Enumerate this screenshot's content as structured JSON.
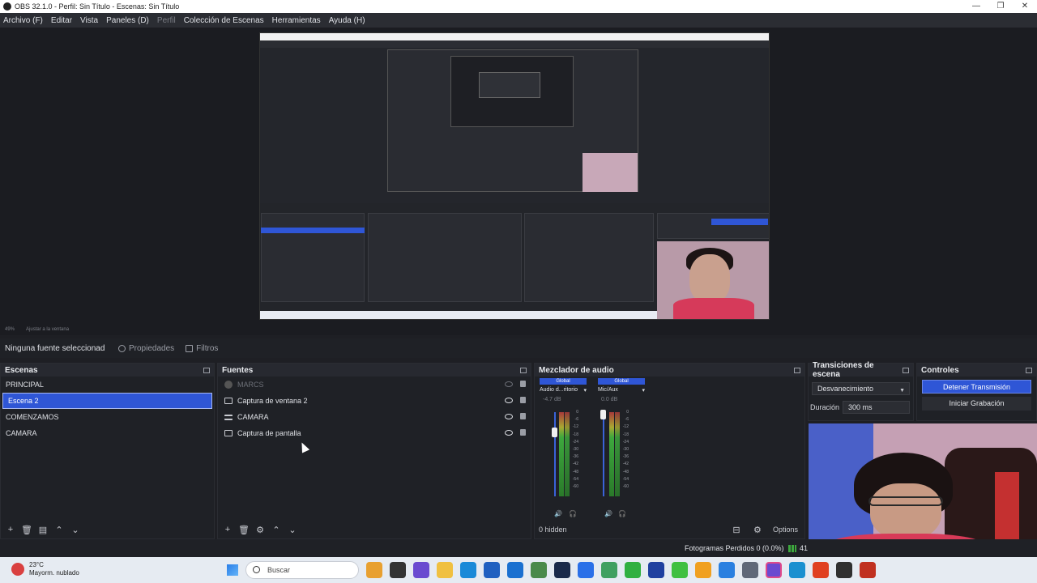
{
  "window": {
    "title": "OBS 32.1.0 - Perfil: Sin Título - Escenas: Sin Título",
    "controls": [
      "—",
      "❐",
      "✕"
    ]
  },
  "menu": {
    "items": [
      {
        "label": "Archivo (F)",
        "enabled": true
      },
      {
        "label": "Editar",
        "enabled": true
      },
      {
        "label": "Vista",
        "enabled": true
      },
      {
        "label": "Paneles (D)",
        "enabled": true
      },
      {
        "label": "Perfil",
        "enabled": false
      },
      {
        "label": "Colección de Escenas",
        "enabled": true
      },
      {
        "label": "Herramientas",
        "enabled": true
      },
      {
        "label": "Ayuda (H)",
        "enabled": true
      }
    ]
  },
  "zoombar": {
    "zoom": "49%",
    "fit": "Ajustar a la ventana"
  },
  "context": {
    "no_source": "Ninguna fuente seleccionad",
    "properties": "Propiedades",
    "filters": "Filtros"
  },
  "scenes": {
    "title": "Escenas",
    "items": [
      {
        "label": "PRINCIPAL",
        "selected": false
      },
      {
        "label": "Escena 2",
        "selected": true
      },
      {
        "label": "COMENZAMOS",
        "selected": false
      },
      {
        "label": "CAMARA",
        "selected": false
      }
    ]
  },
  "sources": {
    "title": "Fuentes",
    "items": [
      {
        "label": "MARCS",
        "visible": false,
        "icon": "image-icon"
      },
      {
        "label": "Captura de ventana 2",
        "visible": true,
        "icon": "window-capture-icon"
      },
      {
        "label": "CAMARA",
        "visible": true,
        "icon": "group-list-icon"
      },
      {
        "label": "Captura de pantalla",
        "visible": true,
        "icon": "display-capture-icon"
      }
    ]
  },
  "audio": {
    "title": "Mezclador de audio",
    "channels": [
      {
        "badge": "Global",
        "name": "Audio d...ritorio",
        "db": "-4.7 dB",
        "level": 0.78
      },
      {
        "badge": "Global",
        "name": "Mic/Aux",
        "db": "0.0 dB",
        "level": 1.0
      }
    ],
    "scale": [
      "0",
      "-6",
      "-12",
      "-18",
      "-24",
      "-30",
      "-36",
      "-42",
      "-48",
      "-54",
      "-60"
    ],
    "hidden": "0 hidden",
    "options": "Options"
  },
  "transitions": {
    "title": "Transiciones de escena",
    "selected": "Desvanecimiento",
    "duration_label": "Duración",
    "duration": "300 ms"
  },
  "controls": {
    "title": "Controles",
    "stop_stream": "Detener Transmisión",
    "start_record": "Iniciar Grabación"
  },
  "status": {
    "dropped": "Fotogramas Perdidos 0 (0.0%)",
    "extra": "41"
  },
  "taskbar": {
    "temp": "23°C",
    "weather": "Mayorm. nublado",
    "search": "Buscar"
  },
  "colors": {
    "accent": "#2f56d6",
    "panel": "#1f2126",
    "header": "#272930"
  }
}
